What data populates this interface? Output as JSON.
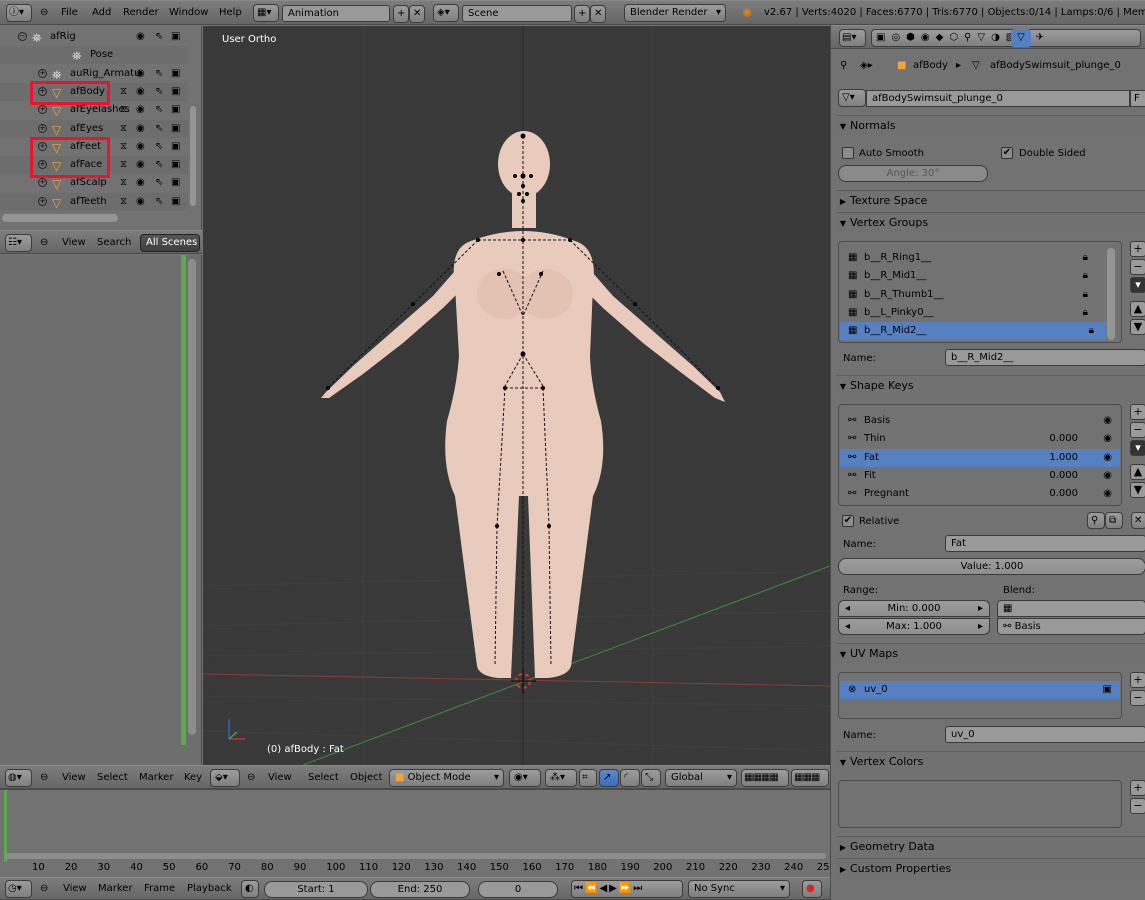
{
  "top_bar": {
    "menus": [
      "File",
      "Add",
      "Render",
      "Window",
      "Help"
    ],
    "screen_layout": "Animation",
    "scene": "Scene",
    "render_engine": "Blender Render",
    "stats": "v2.67 | Verts:4020 | Faces:6770 | Tris:6770 | Objects:0/14 | Lamps:0/6 | Mem:67"
  },
  "outliner": {
    "rows": [
      {
        "name": "afRig",
        "indent": 0
      },
      {
        "name": "Pose",
        "indent": 2
      },
      {
        "name": "auRig_Armatu",
        "indent": 1
      },
      {
        "name": "afBody",
        "indent": 1
      },
      {
        "name": "afEyelashes",
        "indent": 1
      },
      {
        "name": "afEyes",
        "indent": 1
      },
      {
        "name": "afFeet",
        "indent": 1
      },
      {
        "name": "afFace",
        "indent": 1
      },
      {
        "name": "afScalp",
        "indent": 1
      },
      {
        "name": "afTeeth",
        "indent": 1
      }
    ],
    "header": {
      "view": "View",
      "search": "Search",
      "scope": "All Scenes"
    }
  },
  "viewport": {
    "label": "User Ortho",
    "status": "(0) afBody : Fat",
    "header": {
      "menus": [
        "View",
        "Select",
        "Object"
      ],
      "mode": "Object Mode",
      "orientation": "Global"
    }
  },
  "graph_header": {
    "menus": [
      "View",
      "Select",
      "Marker",
      "Key"
    ]
  },
  "timeline": {
    "ticks": [
      "10",
      "20",
      "30",
      "40",
      "50",
      "60",
      "70",
      "80",
      "90",
      "100",
      "110",
      "120",
      "130",
      "140",
      "150",
      "160",
      "170",
      "180",
      "190",
      "200",
      "210",
      "220",
      "230",
      "240",
      "250"
    ],
    "menus": [
      "View",
      "Marker",
      "Frame",
      "Playback"
    ],
    "start": "Start: 1",
    "end": "End: 250",
    "current": "0",
    "sync": "No Sync"
  },
  "properties": {
    "breadcrumb": {
      "object": "afBody",
      "mesh": "afBodySwimsuit_plunge_0"
    },
    "datablock": "afBodySwimsuit_plunge_0",
    "datablock_fake": "F",
    "normals": {
      "title": "Normals",
      "auto_smooth": "Auto Smooth",
      "double_sided": "Double Sided",
      "angle": "Angle: 30°"
    },
    "texture_space": "Texture Space",
    "vertex_groups": {
      "title": "Vertex Groups",
      "items": [
        "b__R_Ring1__",
        "b__R_Mid1__",
        "b__R_Thumb1__",
        "b__L_Pinky0__",
        "b__R_Mid2__"
      ],
      "selected": 4,
      "name_label": "Name:",
      "name_value": "b__R_Mid2__"
    },
    "shape_keys": {
      "title": "Shape Keys",
      "items": [
        {
          "name": "Basis",
          "value": ""
        },
        {
          "name": "Thin",
          "value": "0.000"
        },
        {
          "name": "Fat",
          "value": "1.000"
        },
        {
          "name": "Fit",
          "value": "0.000"
        },
        {
          "name": "Pregnant",
          "value": "0.000"
        }
      ],
      "selected": 2,
      "relative": "Relative",
      "name_label": "Name:",
      "name_value": "Fat",
      "value": "Value: 1.000",
      "range_label": "Range:",
      "blend_label": "Blend:",
      "min": "Min: 0.000",
      "max": "Max: 1.000",
      "relative_key": "Basis"
    },
    "uv_maps": {
      "title": "UV Maps",
      "items": [
        "uv_0"
      ],
      "name_label": "Name:",
      "name_value": "uv_0"
    },
    "vertex_colors": "Vertex Colors",
    "geometry_data": "Geometry Data",
    "custom_properties": "Custom Properties"
  },
  "colors": {
    "selection": "#5680c2",
    "highlight": "#e8152a",
    "viewport_bg": "#393939",
    "object_icon": "#f2a33c"
  }
}
